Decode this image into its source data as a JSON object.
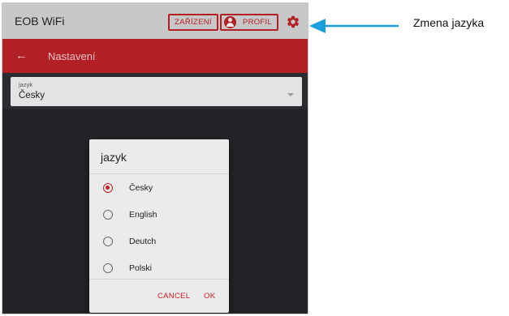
{
  "topbar": {
    "title": "EOB WiFi",
    "devices_label": "ZAŘÍZENÍ",
    "profile_label": "PROFIL",
    "settings_icon": "gear-icon",
    "profile_icon": "user-circle-icon"
  },
  "nav": {
    "back_icon": "arrow-left-icon",
    "back_glyph": "←",
    "title": "Nastavení"
  },
  "language_select": {
    "label": "jazyk",
    "value": "Česky"
  },
  "dialog": {
    "title": "jazyk",
    "options": [
      {
        "label": "Česky",
        "selected": true
      },
      {
        "label": "English",
        "selected": false
      },
      {
        "label": "Deutch",
        "selected": false
      },
      {
        "label": "Polski",
        "selected": false
      }
    ],
    "cancel_label": "CANCEL",
    "ok_label": "OK"
  },
  "annotation": {
    "text": "Zmena jazyka"
  },
  "colors": {
    "accent": "#b21f24",
    "radio_selected": "#c42026",
    "topbar": "#c8c8c8",
    "background": "#2a2c30",
    "annotation_arrow": "#1a9fdc"
  }
}
